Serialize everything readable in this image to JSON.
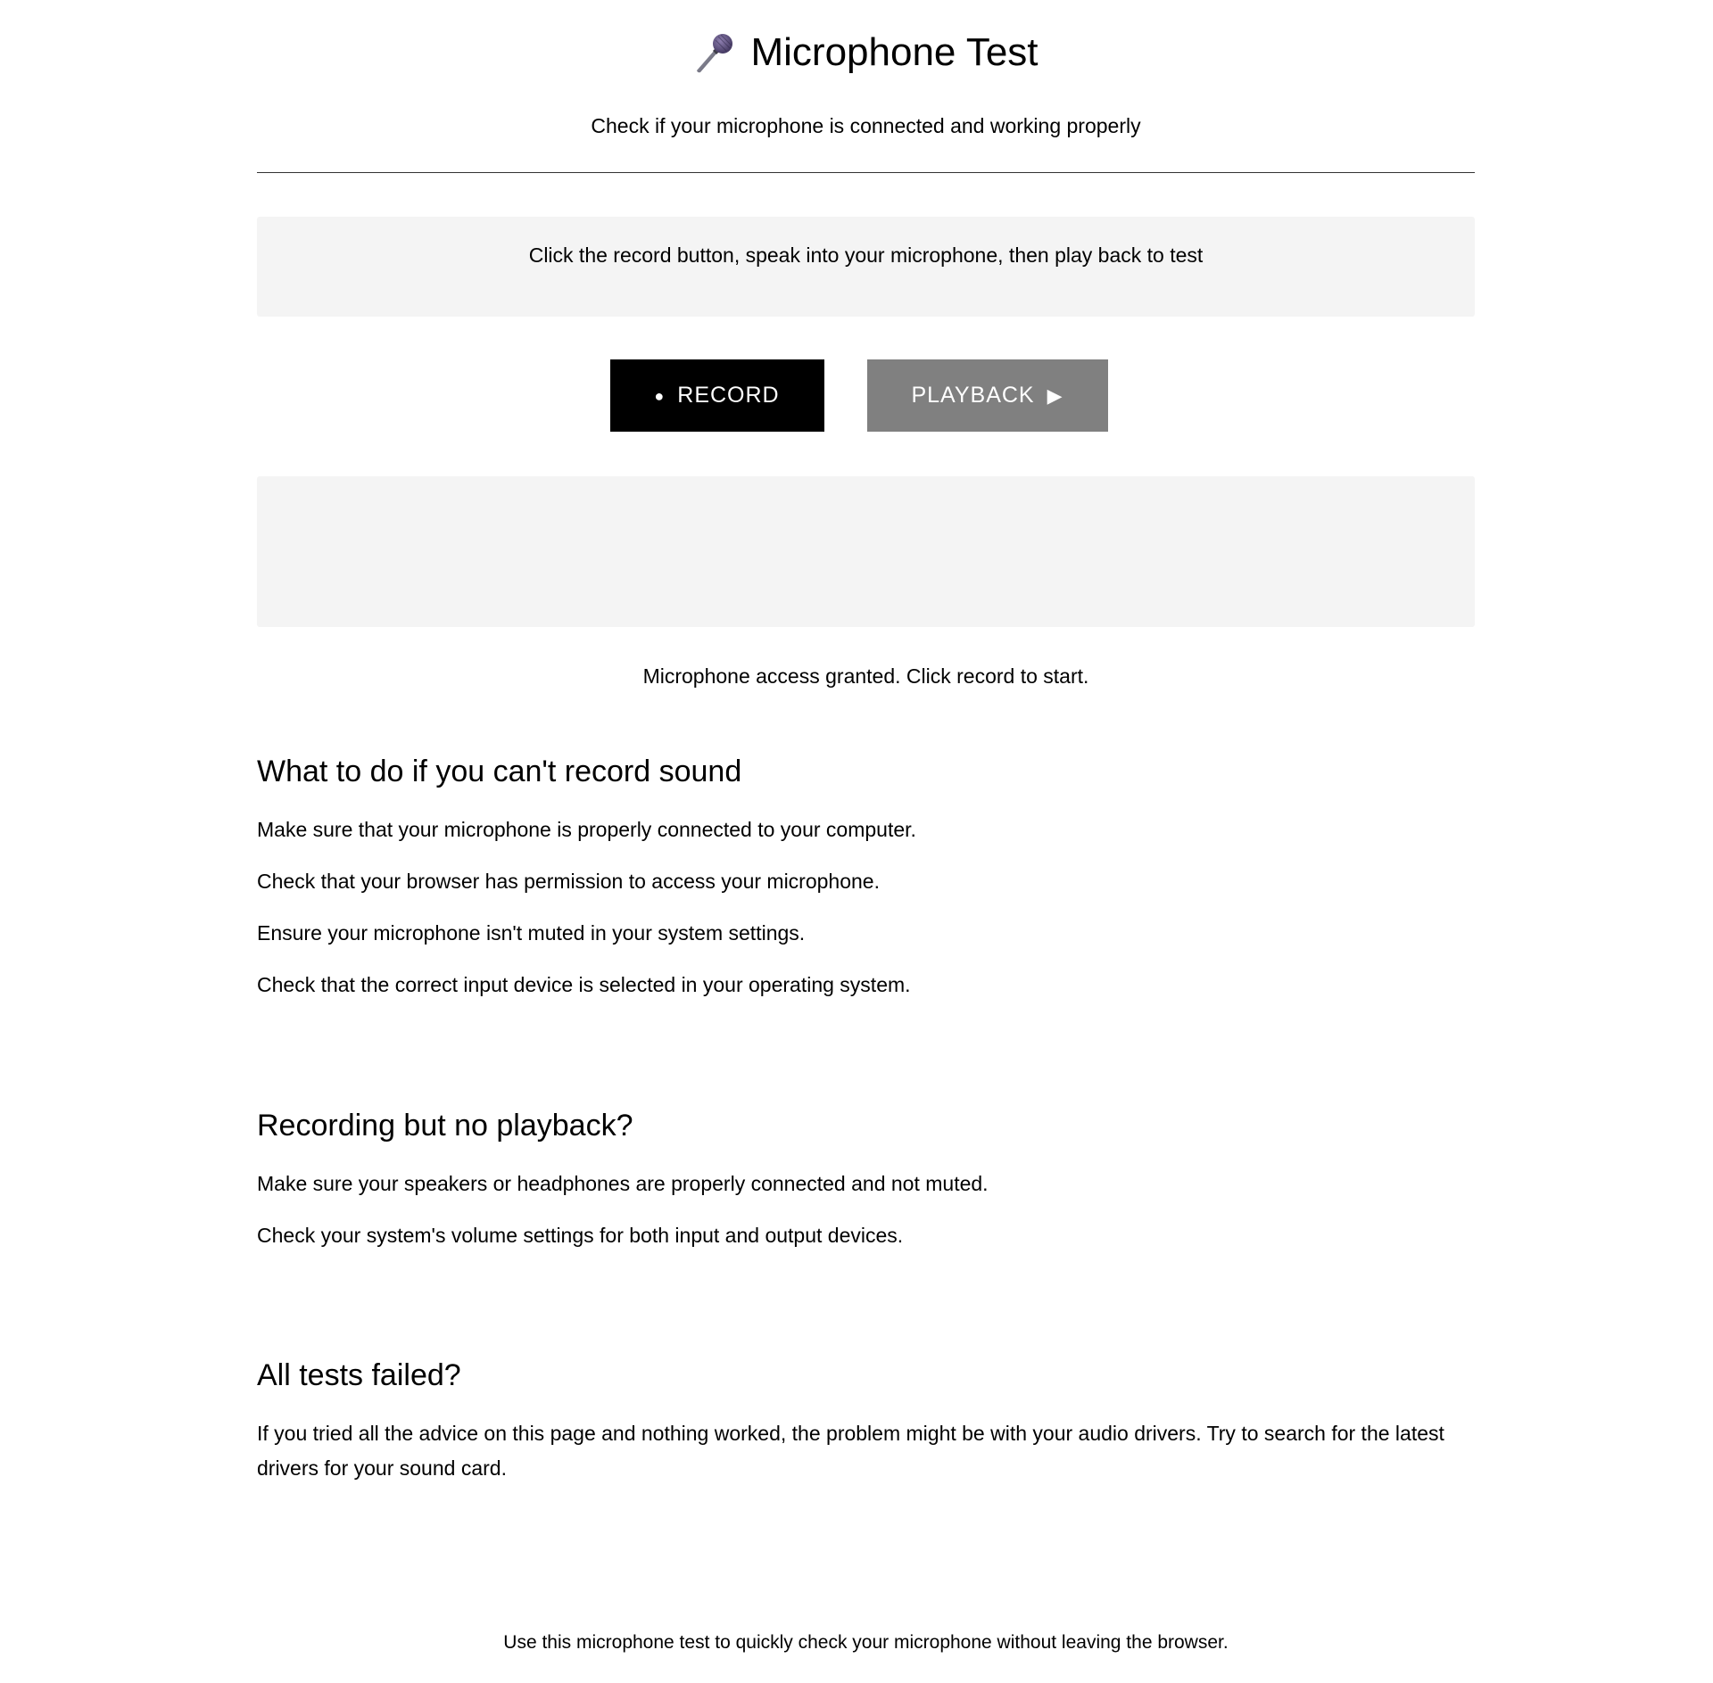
{
  "header": {
    "title": "Microphone Test",
    "subtitle": "Check if your microphone is connected and working properly"
  },
  "instruction": "Click the record button, speak into your microphone, then play back to test",
  "controls": {
    "record_icon": "●",
    "record_label": "RECORD",
    "playback_label": "PLAYBACK",
    "playback_icon": "▶"
  },
  "status_text": "Microphone access granted. Click record to start.",
  "sections": [
    {
      "heading": "What to do if you can't record sound",
      "paragraphs": [
        "Make sure that your microphone is properly connected to your computer.",
        "Check that your browser has permission to access your microphone.",
        "Ensure your microphone isn't muted in your system settings.",
        "Check that the correct input device is selected in your operating system."
      ]
    },
    {
      "heading": "Recording but no playback?",
      "paragraphs": [
        "Make sure your speakers or headphones are properly connected and not muted.",
        "Check your system's volume settings for both input and output devices."
      ]
    },
    {
      "heading": "All tests failed?",
      "paragraphs": [
        "If you tried all the advice on this page and nothing worked, the problem might be with your audio drivers. Try to search for the latest drivers for your sound card."
      ]
    }
  ],
  "footer": "Use this microphone test to quickly check your microphone without leaving the browser.",
  "colors": {
    "record_button": "#000000",
    "playback_button": "#808080",
    "panel_background": "#f4f4f4"
  },
  "icons": {
    "title_icon": "microphone-icon"
  }
}
